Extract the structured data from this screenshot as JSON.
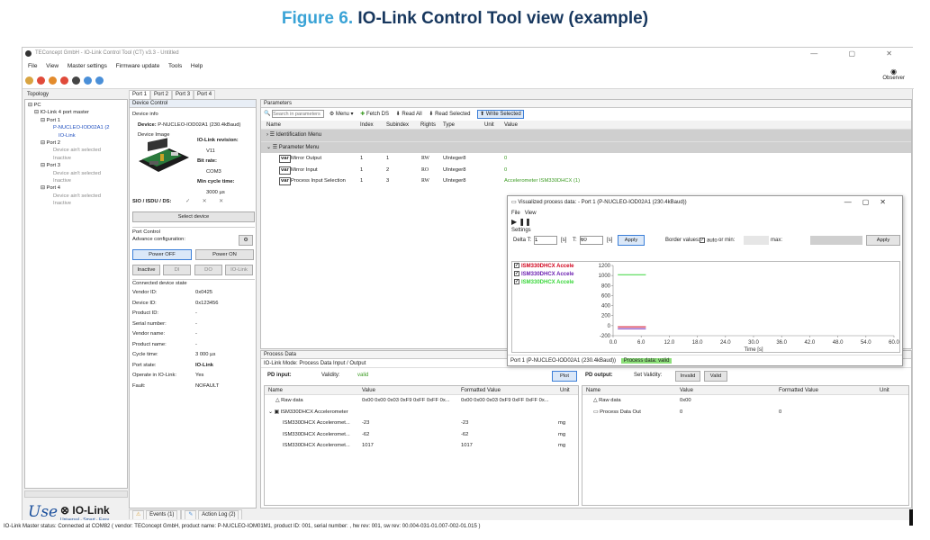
{
  "figure": {
    "num": "Figure 6.",
    "title": "IO-Link Control Tool view (example)"
  },
  "window": {
    "title": "TEConcept GmbH - IO-Link Control Tool (CT) v3.3 - Untitled",
    "controls": [
      "—",
      "▢",
      "✕"
    ]
  },
  "menu": [
    "File",
    "View",
    "Master settings",
    "Firmware update",
    "Tools",
    "Help"
  ],
  "observer": "Observer",
  "toolbar_icons": [
    {
      "name": "stop-icon",
      "color": "#d9a441"
    },
    {
      "name": "record-icon",
      "color": "#e04a3a"
    },
    {
      "name": "cycle-icon",
      "color": "#e38b2c"
    },
    {
      "name": "alert-icon",
      "color": "#e04a3a"
    },
    {
      "name": "device-icon",
      "color": "#444444"
    },
    {
      "name": "connect-icon",
      "color": "#4a8fd8"
    },
    {
      "name": "info-icon",
      "color": "#4a8fd8"
    }
  ],
  "topology": {
    "header": "Topology",
    "pc": "PC",
    "master": "IO-Link 4 port master",
    "port1": "Port 1",
    "port1_device": "P-NUCLEO-IOD02A1 (2",
    "port1_mode": "IO-Link",
    "port2": "Port 2",
    "port2_a": "Device ain't selected",
    "port2_b": "Inactive",
    "port3": "Port 3",
    "port3_a": "Device ain't selected",
    "port3_b": "Inactive",
    "port4": "Port 4",
    "port4_a": "Device ain't selected",
    "port4_b": "Inactive"
  },
  "port_tabs": [
    "Port 1",
    "Port 2",
    "Port 3",
    "Port 4"
  ],
  "device_control": {
    "header": "Device Control",
    "info_label": "Device info",
    "device_label": "Device:",
    "device_value": "P-NUCLEO-IOD02A1 (230.4kBaud)",
    "image_label": "Device Image",
    "io_rev_label": "IO-Link revision:",
    "io_rev_value": "V11",
    "bitrate_label": "Bit rate:",
    "bitrate_value": "COM3",
    "min_cycle_label": "Min cycle time:",
    "min_cycle_value": "3000 µs",
    "sio_label": "SIO / ISDU / DS:",
    "sio_values": [
      "✓",
      "✕",
      "✕"
    ],
    "select_device": "Select device",
    "port_control": "Port Control",
    "advance_config": "Advance configuration:",
    "power_off": "Power OFF",
    "power_on": "Power ON",
    "mode_buttons": [
      "Inactive",
      "DI",
      "DO",
      "IO-Link"
    ],
    "connected_state": "Connected device state",
    "state_rows": [
      {
        "k": "Vendor ID:",
        "v": "0x0425"
      },
      {
        "k": "Device ID:",
        "v": "0x123456"
      },
      {
        "k": "Product ID:",
        "v": "-"
      },
      {
        "k": "Serial number:",
        "v": "-"
      },
      {
        "k": "Vendor name:",
        "v": "-"
      },
      {
        "k": "Product name:",
        "v": "-"
      },
      {
        "k": "Cycle time:",
        "v": "3 000 µs"
      },
      {
        "k": "Port state:",
        "v": "IO-Link"
      },
      {
        "k": "Operate in IO-Link:",
        "v": "Yes"
      },
      {
        "k": "Fault:",
        "v": "NOFAULT"
      }
    ]
  },
  "parameters": {
    "header": "Parameters",
    "search_placeholder": "Search in parameters",
    "buttons": [
      "Menu ▾",
      "Fetch DS",
      "Read All",
      "Read Selected",
      "Write Selected"
    ],
    "columns": [
      "Name",
      "Index",
      "Subindex",
      "Rights",
      "Type",
      "Unit",
      "Value"
    ],
    "menu1": "Identification Menu",
    "menu2": "Parameter Menu",
    "rows": [
      {
        "name": "Mirror Output",
        "index": "1",
        "sub": "1",
        "rights": "RW",
        "type": "UInteger8",
        "unit": "",
        "value": "0"
      },
      {
        "name": "Mirror Input",
        "index": "1",
        "sub": "2",
        "rights": "RO",
        "type": "UInteger8",
        "unit": "",
        "value": "0"
      },
      {
        "name": "Process Input Selection",
        "index": "1",
        "sub": "3",
        "rights": "RW",
        "type": "UInteger8",
        "unit": "",
        "value": "Accelerometer ISM330DHCX (1)"
      }
    ]
  },
  "process_data": {
    "header": "Process Data",
    "mode": "IO-Link Mode: Process Data Input / Output",
    "pd_input": "PD input:",
    "validity_label": "Validity:",
    "validity_value": "valid",
    "plot": "Plot",
    "pd_output": "PD output:",
    "set_validity": "Set Validity:",
    "invalid": "Invalid",
    "valid": "Valid",
    "in_columns": [
      "Name",
      "Value",
      "Formatted Value",
      "Unit"
    ],
    "raw_label": "Raw data",
    "raw_value": "0x00 0x00 0x03 0xF9 0xFF 0xFF 0x...",
    "raw_formatted": "0x00 0x00 0x03 0xF9 0xFF 0xFF 0x...",
    "group": "ISM330DHCX Accelerometer",
    "in_rows": [
      {
        "name": "ISM330DHCX Acceleromet...",
        "value": "-23",
        "fmt": "-23",
        "unit": "mg"
      },
      {
        "name": "ISM330DHCX Acceleromet...",
        "value": "-62",
        "fmt": "-62",
        "unit": "mg"
      },
      {
        "name": "ISM330DHCX Acceleromet...",
        "value": "1017",
        "fmt": "1017",
        "unit": "mg"
      }
    ],
    "out_columns": [
      "Name",
      "Value",
      "Formatted Value",
      "Unit"
    ],
    "out_raw_label": "Raw data",
    "out_raw_value": "0x00",
    "out_pd_label": "Process Data Out",
    "out_pd_value": "0",
    "out_pd_fmt": "0"
  },
  "vpd": {
    "title": "Visualized process data: - Port 1 (P-NUCLEO-IOD02A1 (230.4kBaud))",
    "menu": [
      "File",
      "View"
    ],
    "settings": "Settings",
    "delta_label": "Delta T:",
    "delta_value": "1",
    "unit_s": "[s]",
    "t_label": "T:",
    "t_value": "60",
    "apply": "Apply",
    "border_label": "Border values:",
    "auto_label": "auto",
    "or_min": "or  min:",
    "max_label": "max:",
    "apply2": "Apply",
    "footer_port": "Port 1 (P-NUCLEO-IOD02A1 (230.4kBaud))",
    "footer_status": "Process data: valid",
    "colors": {
      "s1": "#d0021b",
      "s2": "#6b1fb0",
      "s3": "#39d63a"
    }
  },
  "chart_data": {
    "type": "line",
    "xlabel": "Time [s]",
    "ylabel": "",
    "xlim": [
      0,
      60
    ],
    "ylim": [
      -200,
      1200
    ],
    "xticks": [
      "0.0",
      "6.0",
      "12.0",
      "18.0",
      "24.0",
      "30.0",
      "36.0",
      "42.0",
      "48.0",
      "54.0",
      "60.0"
    ],
    "yticks": [
      "1200",
      "1000",
      "800",
      "600",
      "400",
      "200",
      "0",
      "-200"
    ],
    "series": [
      {
        "name": "ISM330DHCX Accele",
        "color": "#d0021b",
        "x": [
          1,
          7
        ],
        "y": [
          -23,
          -23
        ]
      },
      {
        "name": "ISM330DHCX Accele",
        "color": "#6b1fb0",
        "x": [
          1,
          7
        ],
        "y": [
          -62,
          -62
        ]
      },
      {
        "name": "ISM330DHCX Accele",
        "color": "#39d63a",
        "x": [
          1,
          7
        ],
        "y": [
          1017,
          1017
        ]
      }
    ]
  },
  "events_tab": "Events (1)",
  "action_tab": "Action Log (2)",
  "logo": {
    "use": "Use",
    "io": "IO-Link",
    "tag": "Universal · Smart · Easy"
  },
  "status_bar": "IO-Link Master status:  Connected at COM82    ( vendor: TEConcept GmbH, product name: P-NUCLEO-IOM01M1, product ID: 001, serial number: , hw rev: 001, sw rev: 00.004-031-01.007-002-01.015 )"
}
